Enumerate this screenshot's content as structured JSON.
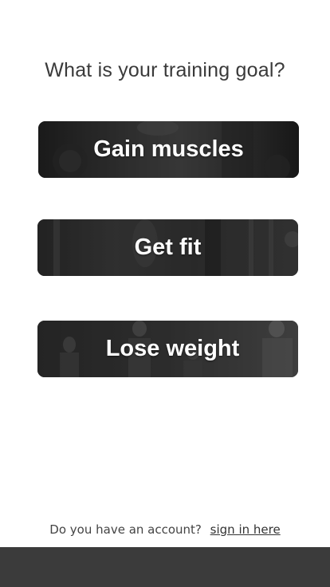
{
  "page": {
    "question": "What is your training goal?"
  },
  "goals": [
    {
      "label": "Gain muscles"
    },
    {
      "label": "Get fit"
    },
    {
      "label": "Lose weight"
    }
  ],
  "footer": {
    "account_question": "Do you have an account?",
    "signin_link": "sign in here"
  },
  "colors": {
    "background": "#ffffff",
    "bottom_bar": "#3b3b3b",
    "card_text": "#ffffff",
    "question_text": "#3a3a3a"
  }
}
